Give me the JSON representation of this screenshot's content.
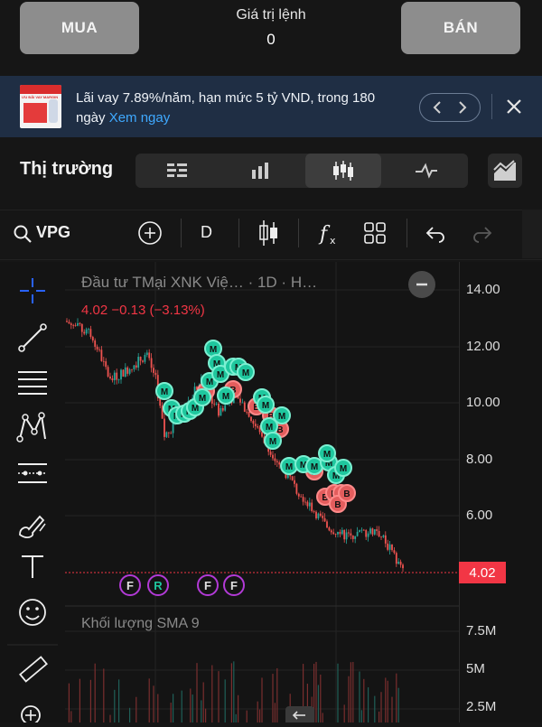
{
  "order_bar": {
    "buy_label": "MUA",
    "sell_label": "BÁN",
    "value_label": "Giá trị lệnh",
    "value": "0"
  },
  "promo": {
    "text": "Lãi vay 7.89%/năm, hạn mức 5 tỷ VND, trong 180 ngày",
    "link_text": "Xem ngay",
    "thumb_text": "ƯU ĐÃI VAY MARGIN"
  },
  "market": {
    "title": "Thị trường"
  },
  "toolbar": {
    "symbol": "VPG",
    "interval": "D"
  },
  "chart": {
    "title": "Đầu tư TMại XNK Việ… · 1D · H…",
    "change_text": "4.02  −0.13 (−3.13%)",
    "current_price": "4.02",
    "price_ticks": [
      "14.00",
      "12.00",
      "10.00",
      "8.00",
      "6.00"
    ],
    "volume_title": "Khối lượng SMA 9",
    "volume_ticks": [
      "7.5M",
      "5M",
      "2.5M"
    ],
    "event_markers": [
      "F",
      "R",
      "F",
      "F"
    ],
    "trade_markers_m": "M",
    "trade_markers_b": "B",
    "colors": {
      "up": "#26a69a",
      "down": "#ef5350",
      "accent": "#2962ff",
      "event": "#b23ad6"
    }
  }
}
